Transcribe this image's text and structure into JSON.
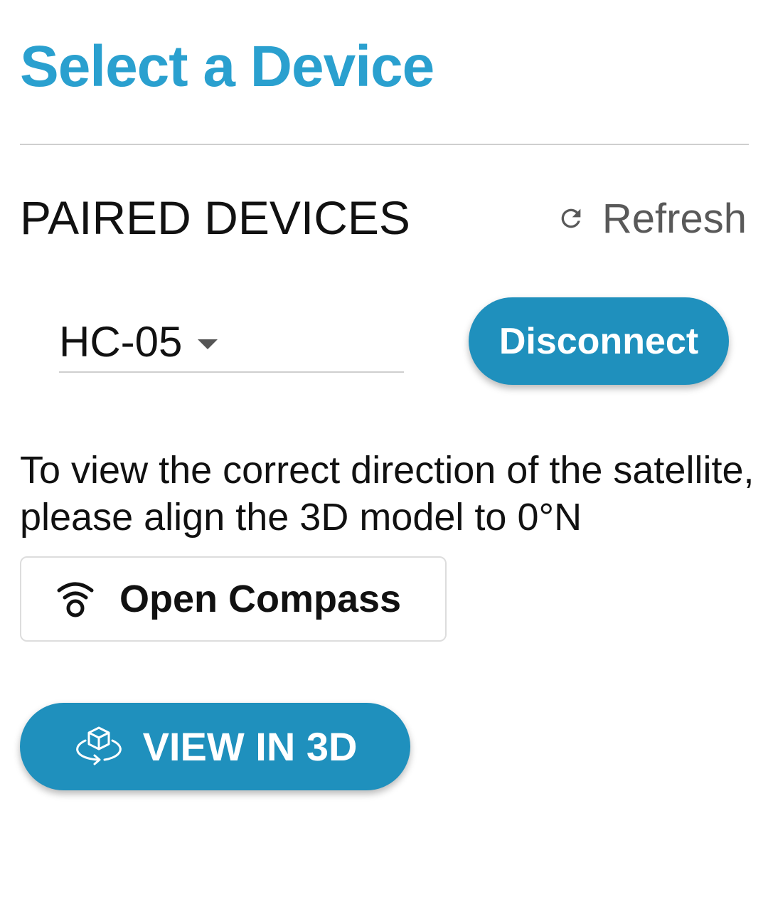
{
  "header": {
    "title": "Select a Device"
  },
  "paired_section": {
    "label": "PAIRED DEVICES",
    "refresh_label": "Refresh",
    "refresh_icon": "refresh-icon"
  },
  "device_select": {
    "selected": "HC-05",
    "caret_icon": "chevron-down-icon"
  },
  "actions": {
    "disconnect_label": "Disconnect"
  },
  "instructions": {
    "text": "To view the correct direction of the satellite, please align the 3D model to 0°N"
  },
  "compass": {
    "label": "Open Compass",
    "icon": "compass-icon"
  },
  "view3d": {
    "label": "VIEW IN 3D",
    "icon": "cube-rotate-icon"
  },
  "colors": {
    "accent": "#2aa0cf",
    "button": "#1f90bd",
    "divider": "#cfcfcf",
    "muted_text": "#595959"
  }
}
